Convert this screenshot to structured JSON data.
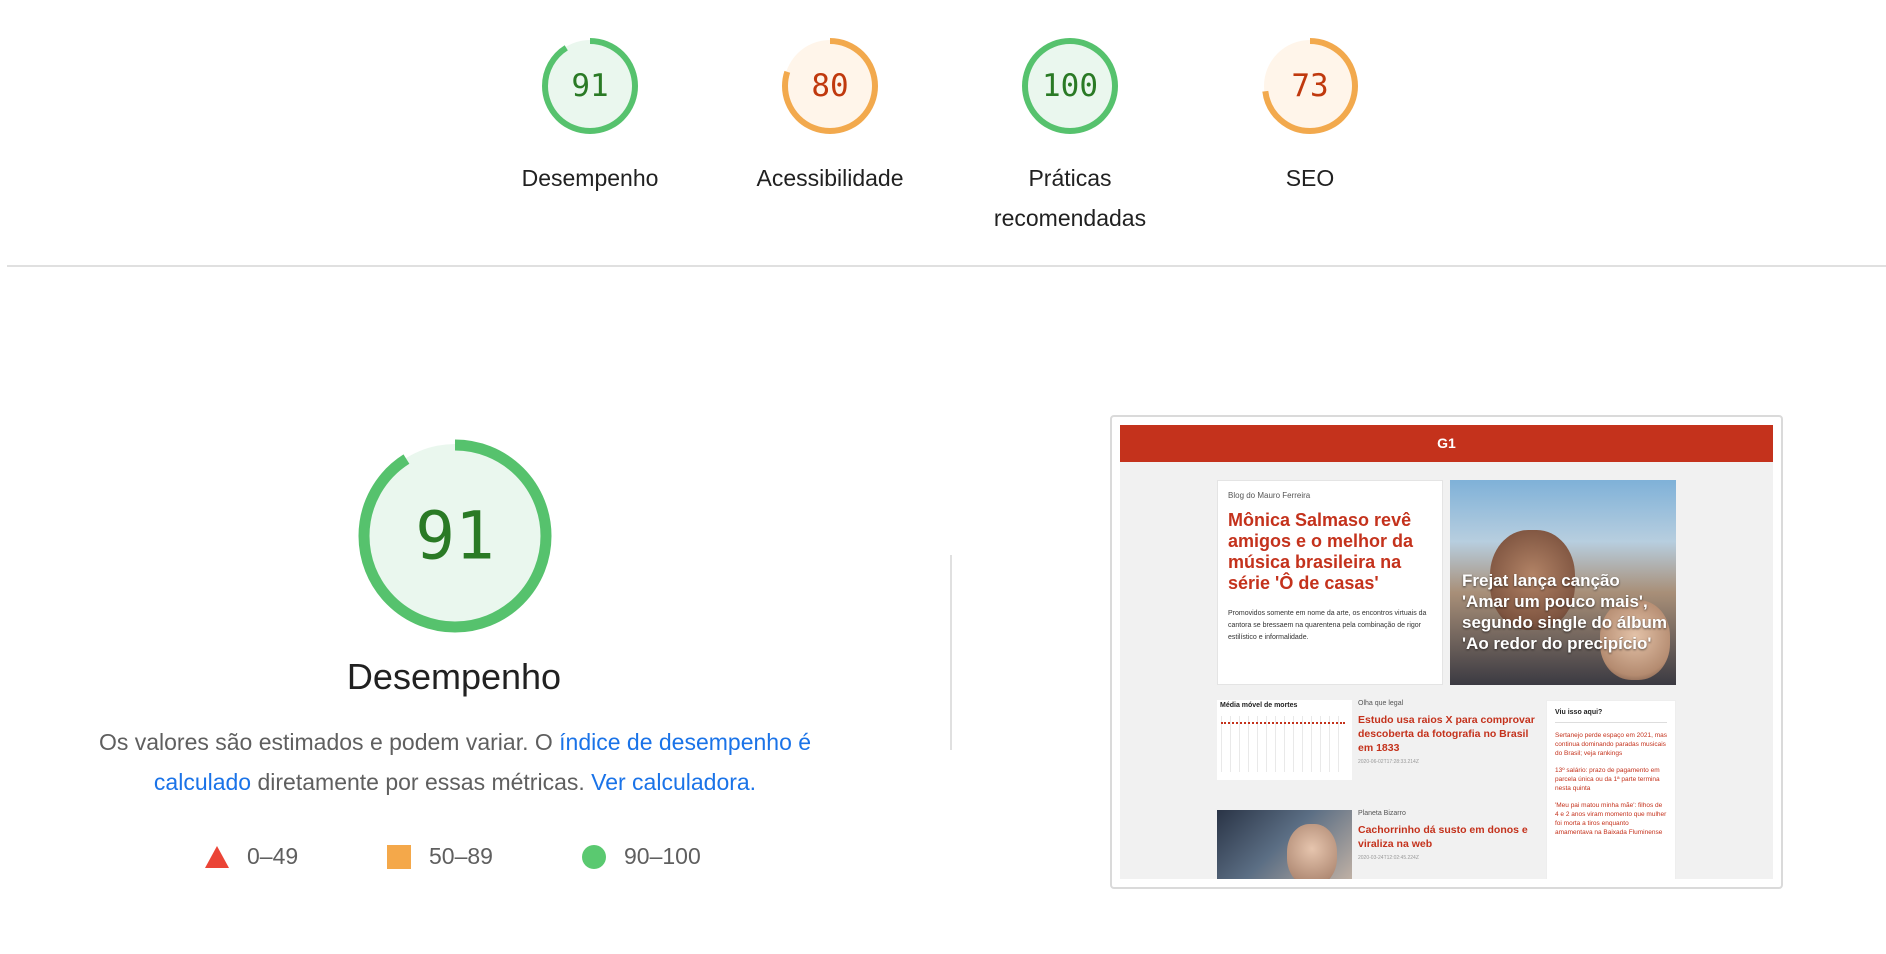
{
  "scores": [
    {
      "value": 91,
      "score": 0.91,
      "label": "Desempenho",
      "color": "#0cce6b",
      "ring_color": "#56c26d",
      "text_color": "#2a7a25",
      "fill": "#eaf7ee"
    },
    {
      "value": 80,
      "score": 0.8,
      "label": "Acessibilidade",
      "color": "#ffa400",
      "ring_color": "#f2a94d",
      "text_color": "#c0390e",
      "fill": "#fff5ea"
    },
    {
      "value": 100,
      "score": 1.0,
      "label": "Práticas recomendadas",
      "color": "#0cce6b",
      "ring_color": "#56c26d",
      "text_color": "#2a7a25",
      "fill": "#eaf7ee"
    },
    {
      "value": 73,
      "score": 0.73,
      "label": "SEO",
      "color": "#ffa400",
      "ring_color": "#f2a94d",
      "text_color": "#c0390e",
      "fill": "#fff5ea"
    }
  ],
  "main": {
    "value": 91,
    "score": 0.91,
    "title": "Desempenho",
    "desc_prefix": "Os valores são estimados e podem variar. O ",
    "desc_link": "índice de desempenho é calculado",
    "desc_middle": " diretamente por essas métricas. ",
    "desc_calc_link": "Ver calculadora."
  },
  "legend": [
    {
      "shape": "triangle",
      "color": "#eb4436",
      "label": "0–49"
    },
    {
      "shape": "square",
      "color": "#f4a84a",
      "label": "50–89"
    },
    {
      "shape": "circle",
      "color": "#5ac970",
      "label": "90–100"
    }
  ],
  "thumbnail": {
    "brand": "G1",
    "kicker": "Blog do Mauro Ferreira",
    "headline": "Mônica Salmaso revê amigos e o melhor da música brasileira na série 'Ô de casas'",
    "summary": "Promovidos somente em nome da arte, os encontros virtuais da cantora se bressaem na quarentena pela combinação de rigor estilístico e informalidade.",
    "photo_headline": "Frejat lança canção 'Amar um pouco mais', segundo single do álbum 'Ao redor do precipício'",
    "chart_title": "Média móvel de mortes",
    "news": [
      {
        "kicker": "Olha que legal",
        "headline": "Estudo usa raios X para comprovar descoberta da fotografia no Brasil em 1833",
        "date": "2020-06-02T17:28:33.214Z"
      },
      {
        "kicker": "Planeta Bizarro",
        "headline": "Cachorrinho dá susto em donos e viraliza na web",
        "date": "2020-03-24T12:02:45.224Z"
      }
    ],
    "side_title": "Viu isso aqui?",
    "side_items": [
      "Sertanejo perde espaço em 2021, mas continua dominando paradas musicais do Brasil; veja rankings",
      "13º salário: prazo de pagamento em parcela única ou da 1ª parte termina nesta quinta",
      "'Meu pai matou minha mãe': filhos de 4 e 2 anos viram momento que mulher foi morta a tiros enquanto amamentava na Baixada Fluminense"
    ]
  }
}
